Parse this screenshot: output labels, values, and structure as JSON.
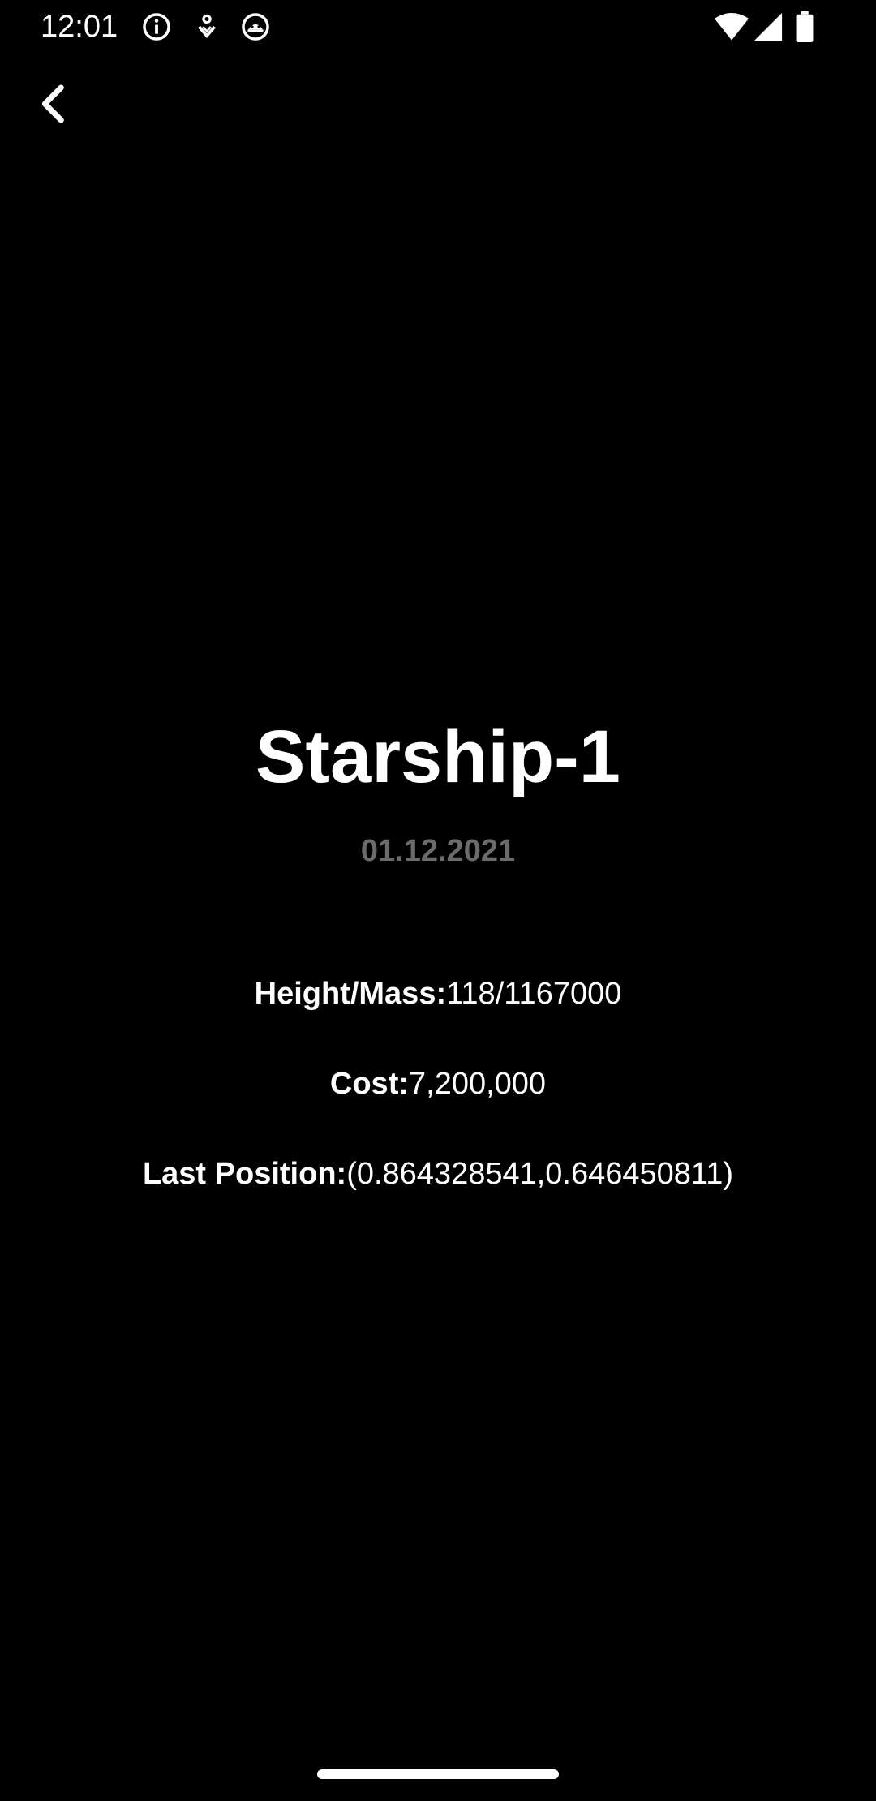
{
  "status_bar": {
    "time": "12:01",
    "notification_icons": [
      "info-icon",
      "download-icon",
      "android-icon"
    ],
    "system_icons": [
      "wifi-icon",
      "signal-icon",
      "battery-icon"
    ]
  },
  "toolbar": {
    "back_icon": "chevron-left-icon"
  },
  "detail": {
    "title": "Starship-1",
    "date": "01.12.2021",
    "rows": [
      {
        "label": "Height/Mass:",
        "value": "118/1167000"
      },
      {
        "label": "Cost:",
        "value": "7,200,000"
      },
      {
        "label": "Last Position:",
        "value": "(0.864328541,0.646450811)"
      }
    ]
  },
  "colors": {
    "background": "#000000",
    "text": "#ffffff",
    "date_text": "#6b6b6b"
  }
}
